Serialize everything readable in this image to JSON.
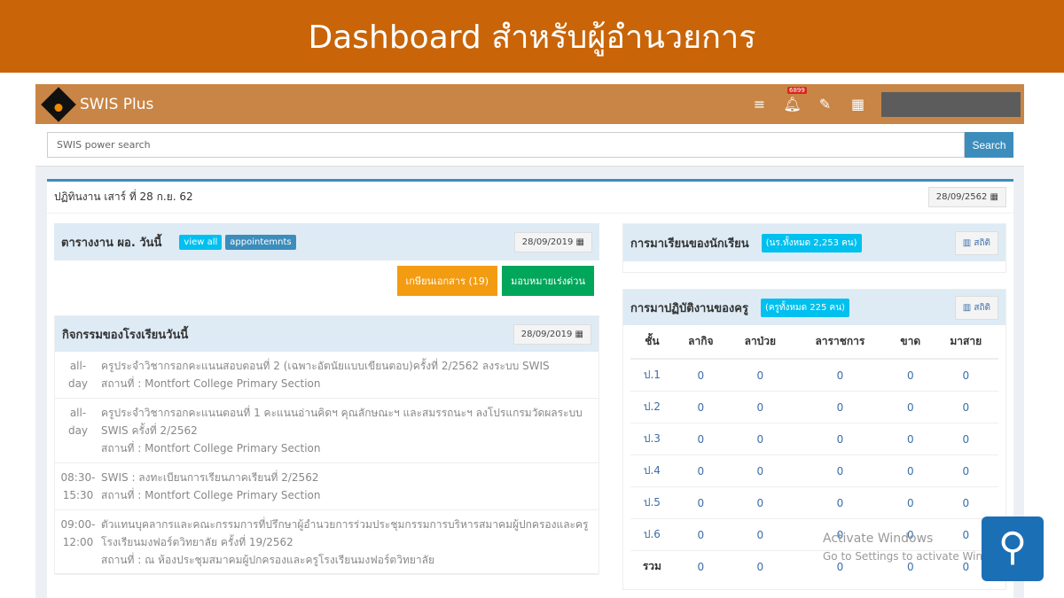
{
  "banner": {
    "title": "Dashboard สำหรับผู้อำนวยการ"
  },
  "nav": {
    "brand": "SWIS Plus",
    "notif_count": "6899"
  },
  "search": {
    "placeholder": "SWIS power search",
    "button": "Search"
  },
  "main": {
    "title": "ปฏิทินงาน เสาร์ ที่ 28 ก.ย. 62",
    "date": "28/09/2562"
  },
  "schedule": {
    "title": "ตารางงาน ผอ. วันนี้",
    "view_all": "view all",
    "appointments": "appointemnts",
    "date": "28/09/2019",
    "docs_btn": "เกษียนเอกสาร (19)",
    "urgent_btn": "มอบหมายเร่งด่วน"
  },
  "activities": {
    "title": "กิจกรรมของโรงเรียนวันนี้",
    "date": "28/09/2019",
    "events": [
      {
        "time1": "all-",
        "time2": "day",
        "lines": [
          "ครูประจำวิชากรอกคะแนนสอบตอนที่ 2 (เฉพาะอัตนัยแบบเขียนตอบ)ครั้งที่ 2/2562 ลงระบบ SWIS",
          "สถานที่ : Montfort College Primary Section"
        ]
      },
      {
        "time1": "all-",
        "time2": "day",
        "lines": [
          "ครูประจำวิชากรอกคะแนนตอนที่ 1 คะแนนอ่านคิดฯ คุณลักษณะฯ และสมรรถนะฯ ลงโปรแกรมวัดผลระบบ SWIS ครั้งที่ 2/2562",
          "สถานที่ : Montfort College Primary Section"
        ]
      },
      {
        "time1": "08:30-",
        "time2": "15:30",
        "lines": [
          "SWIS : ลงทะเบียนการเรียนภาคเรียนที่ 2/2562",
          "สถานที่ : Montfort College Primary Section"
        ]
      },
      {
        "time1": "09:00-",
        "time2": "12:00",
        "lines": [
          "ตัวแทนบุคลากรและคณะกรรมการที่ปรึกษาผู้อำนวยการร่วมประชุมกรรมการบริหารสมาคมผู้ปกครองและครูโรงเรียนมงฟอร์ตวิทยาลัย ครั้งที่ 19/2562",
          "สถานที่ : ณ ห้องประชุมสมาคมผู้ปกครองและครูโรงเรียนมงฟอร์ตวิทยาลัย"
        ]
      }
    ]
  },
  "students": {
    "title": "การมาเรียนของนักเรียน",
    "badge": "(นร.ทั้งหมด 2,253 คน)",
    "stats": "สถิติ"
  },
  "teachers": {
    "title": "การมาปฏิบัติงานของครู",
    "badge": "(ครูทั้งหมด 225 คน)",
    "stats": "สถิติ",
    "columns": [
      "ชั้น",
      "ลากิจ",
      "ลาป่วย",
      "ลาราชการ",
      "ขาด",
      "มาสาย"
    ],
    "rows": [
      [
        "ป.1",
        "0",
        "0",
        "0",
        "0",
        "0"
      ],
      [
        "ป.2",
        "0",
        "0",
        "0",
        "0",
        "0"
      ],
      [
        "ป.3",
        "0",
        "0",
        "0",
        "0",
        "0"
      ],
      [
        "ป.4",
        "0",
        "0",
        "0",
        "0",
        "0"
      ],
      [
        "ป.5",
        "0",
        "0",
        "0",
        "0",
        "0"
      ],
      [
        "ป.6",
        "0",
        "0",
        "0",
        "0",
        "0"
      ],
      [
        "รวม",
        "0",
        "0",
        "0",
        "0",
        "0"
      ]
    ]
  },
  "watermark": {
    "line1": "Activate Windows",
    "line2": "Go to Settings to activate Windows."
  }
}
